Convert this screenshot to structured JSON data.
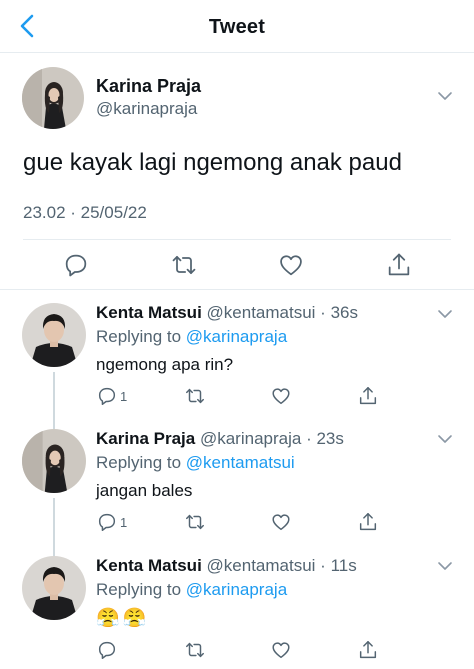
{
  "header": {
    "title": "Tweet"
  },
  "tweet": {
    "author_name": "Karina Praja",
    "author_handle": "@karinapraja",
    "text": "gue kayak lagi ngemong anak paud",
    "timestamp": "23.02 · 25/05/22"
  },
  "replies": [
    {
      "author_name": "Kenta Matsui",
      "author_handle": "@kentamatsui",
      "time": "36s",
      "replying_prefix": "Replying to",
      "replying_to": "@karinapraja",
      "text": "ngemong apa rin?",
      "reply_count": "1"
    },
    {
      "author_name": "Karina Praja",
      "author_handle": "@karinapraja",
      "time": "23s",
      "replying_prefix": "Replying to",
      "replying_to": "@kentamatsui",
      "text": "jangan bales",
      "reply_count": "1"
    },
    {
      "author_name": "Kenta Matsui",
      "author_handle": "@kentamatsui",
      "time": "11s",
      "replying_prefix": "Replying to",
      "replying_to": "@karinapraja",
      "text": "😤😤",
      "reply_count": ""
    }
  ],
  "colors": {
    "accent": "#1d9bf0",
    "secondary_text": "#536471",
    "divider": "#e6ecf0"
  },
  "icons": [
    "back-arrow-icon",
    "chevron-down-icon",
    "reply-icon",
    "retweet-icon",
    "like-icon",
    "share-icon"
  ]
}
